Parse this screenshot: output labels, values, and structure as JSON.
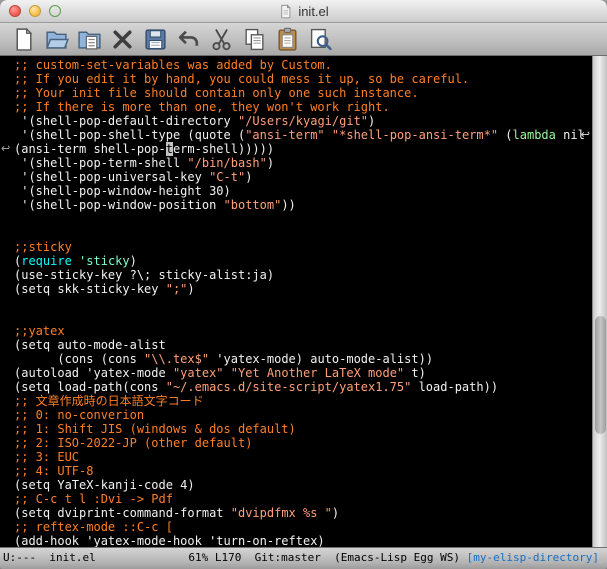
{
  "titlebar": {
    "title": "init.el"
  },
  "window_controls": [
    "close",
    "minimize",
    "zoom"
  ],
  "toolbar": {
    "icons": [
      "new-file",
      "open-file",
      "dired",
      "close-buffer",
      "save",
      "undo",
      "cut",
      "copy",
      "paste",
      "search"
    ]
  },
  "editor": {
    "wrap_glyph": "↩",
    "wrap_right_line": 6,
    "wrap_left_line": 7,
    "lines": [
      {
        "segs": [
          [
            "cm",
            ";; custom-set-variables was added by Custom."
          ]
        ]
      },
      {
        "segs": [
          [
            "cm",
            ";; If you edit it by hand, you could mess it up, so be careful."
          ]
        ]
      },
      {
        "segs": [
          [
            "cm",
            ";; Your init file should contain only one such instance."
          ]
        ]
      },
      {
        "segs": [
          [
            "cm",
            ";; If there is more than one, they won't work right."
          ]
        ]
      },
      {
        "segs": [
          [
            "d",
            " '(shell-pop-default-directory "
          ],
          [
            "st",
            "\"/Users/kyagi/git\""
          ],
          [
            "d",
            ")"
          ]
        ]
      },
      {
        "segs": [
          [
            "d",
            " '(shell-pop-shell-type (quote ("
          ],
          [
            "st",
            "\"ansi-term\""
          ],
          [
            "d",
            " "
          ],
          [
            "st",
            "\"*shell-pop-ansi-term*\""
          ],
          [
            "d",
            " ("
          ],
          [
            "ty",
            "lambda"
          ],
          [
            "d",
            " nil"
          ]
        ]
      },
      {
        "segs": [
          [
            "d",
            "(ansi-term shell-pop-"
          ],
          [
            "cur",
            "t"
          ],
          [
            "d",
            "erm-shell)))))"
          ]
        ]
      },
      {
        "segs": [
          [
            "d",
            " '(shell-pop-term-shell "
          ],
          [
            "st",
            "\"/bin/bash\""
          ],
          [
            "d",
            ")"
          ]
        ]
      },
      {
        "segs": [
          [
            "d",
            " '(shell-pop-universal-key "
          ],
          [
            "st",
            "\"C-t\""
          ],
          [
            "d",
            ")"
          ]
        ]
      },
      {
        "segs": [
          [
            "d",
            " '(shell-pop-window-height 30)"
          ]
        ]
      },
      {
        "segs": [
          [
            "d",
            " '(shell-pop-window-position "
          ],
          [
            "st",
            "\"bottom\""
          ],
          [
            "d",
            "))"
          ]
        ]
      },
      {
        "segs": []
      },
      {
        "segs": []
      },
      {
        "segs": [
          [
            "cm",
            ";;sticky"
          ]
        ]
      },
      {
        "segs": [
          [
            "d",
            "("
          ],
          [
            "kw",
            "require"
          ],
          [
            "d",
            " "
          ],
          [
            "cn",
            "'sticky"
          ],
          [
            "d",
            ")"
          ]
        ]
      },
      {
        "segs": [
          [
            "d",
            "(use-sticky-key ?\\; sticky-alist:ja)"
          ]
        ]
      },
      {
        "segs": [
          [
            "d",
            "(setq skk-sticky-key "
          ],
          [
            "st",
            "\";\""
          ],
          [
            "d",
            ")"
          ]
        ]
      },
      {
        "segs": []
      },
      {
        "segs": []
      },
      {
        "segs": [
          [
            "cm",
            ";;yatex"
          ]
        ]
      },
      {
        "segs": [
          [
            "d",
            "(setq auto-mode-alist"
          ]
        ]
      },
      {
        "segs": [
          [
            "d",
            "      (cons (cons "
          ],
          [
            "st",
            "\"\\\\.tex$\""
          ],
          [
            "d",
            " 'yatex-mode) auto-mode-alist))"
          ]
        ]
      },
      {
        "segs": [
          [
            "d",
            "(autoload 'yatex-mode "
          ],
          [
            "st",
            "\"yatex\""
          ],
          [
            "d",
            " "
          ],
          [
            "st",
            "\"Yet Another LaTeX mode\""
          ],
          [
            "d",
            " t)"
          ]
        ]
      },
      {
        "segs": [
          [
            "d",
            "(setq load-path(cons "
          ],
          [
            "st",
            "\"~/.emacs.d/site-script/yatex1.75\""
          ],
          [
            "d",
            " load-path))"
          ]
        ]
      },
      {
        "segs": [
          [
            "cm",
            ";; 文章作成時の日本語文字コード"
          ]
        ]
      },
      {
        "segs": [
          [
            "cm",
            ";; 0: no-converion"
          ]
        ]
      },
      {
        "segs": [
          [
            "cm",
            ";; 1: Shift JIS (windows & dos default)"
          ]
        ]
      },
      {
        "segs": [
          [
            "cm",
            ";; 2: ISO-2022-JP (other default)"
          ]
        ]
      },
      {
        "segs": [
          [
            "cm",
            ";; 3: EUC"
          ]
        ]
      },
      {
        "segs": [
          [
            "cm",
            ";; 4: UTF-8"
          ]
        ]
      },
      {
        "segs": [
          [
            "d",
            "(setq YaTeX-kanji-code 4)"
          ]
        ]
      },
      {
        "segs": [
          [
            "cm",
            ";; C-c t l :Dvi -> Pdf"
          ]
        ]
      },
      {
        "segs": [
          [
            "d",
            "(setq dviprint-command-format "
          ],
          [
            "st",
            "\"dvipdfmx %s \""
          ],
          [
            "d",
            ")"
          ]
        ]
      },
      {
        "segs": [
          [
            "cm",
            ";; reftex-mode ::C-c ["
          ]
        ]
      },
      {
        "segs": [
          [
            "d",
            "(add-hook 'yatex-mode-hook 'turn-on-reftex)"
          ]
        ]
      }
    ]
  },
  "scrollbar": {
    "thumb_top_pct": 53,
    "thumb_height_pct": 24
  },
  "modeline": {
    "left": "U:---  init.el              61% L170  Git:master  (Emacs-Lisp Egg WS) ",
    "link": "[my-elisp-directory]",
    "percent": "61%",
    "line": "L170",
    "branch": "Git:master",
    "modes": "(Emacs-Lisp Egg WS)"
  },
  "colors": {
    "background": "#000000",
    "comment": "#ff7f24",
    "string": "#ffa07a",
    "keyword": "#00ffff",
    "constant": "#7fffd4",
    "type": "#98fb98",
    "default_text": "#f2f2f2",
    "cursor": "#c3c3c3",
    "modeline_link": "#1a6ec0",
    "traffic_red": "#f06156",
    "traffic_yellow": "#f6bf4f",
    "traffic_green": "#65c958"
  }
}
